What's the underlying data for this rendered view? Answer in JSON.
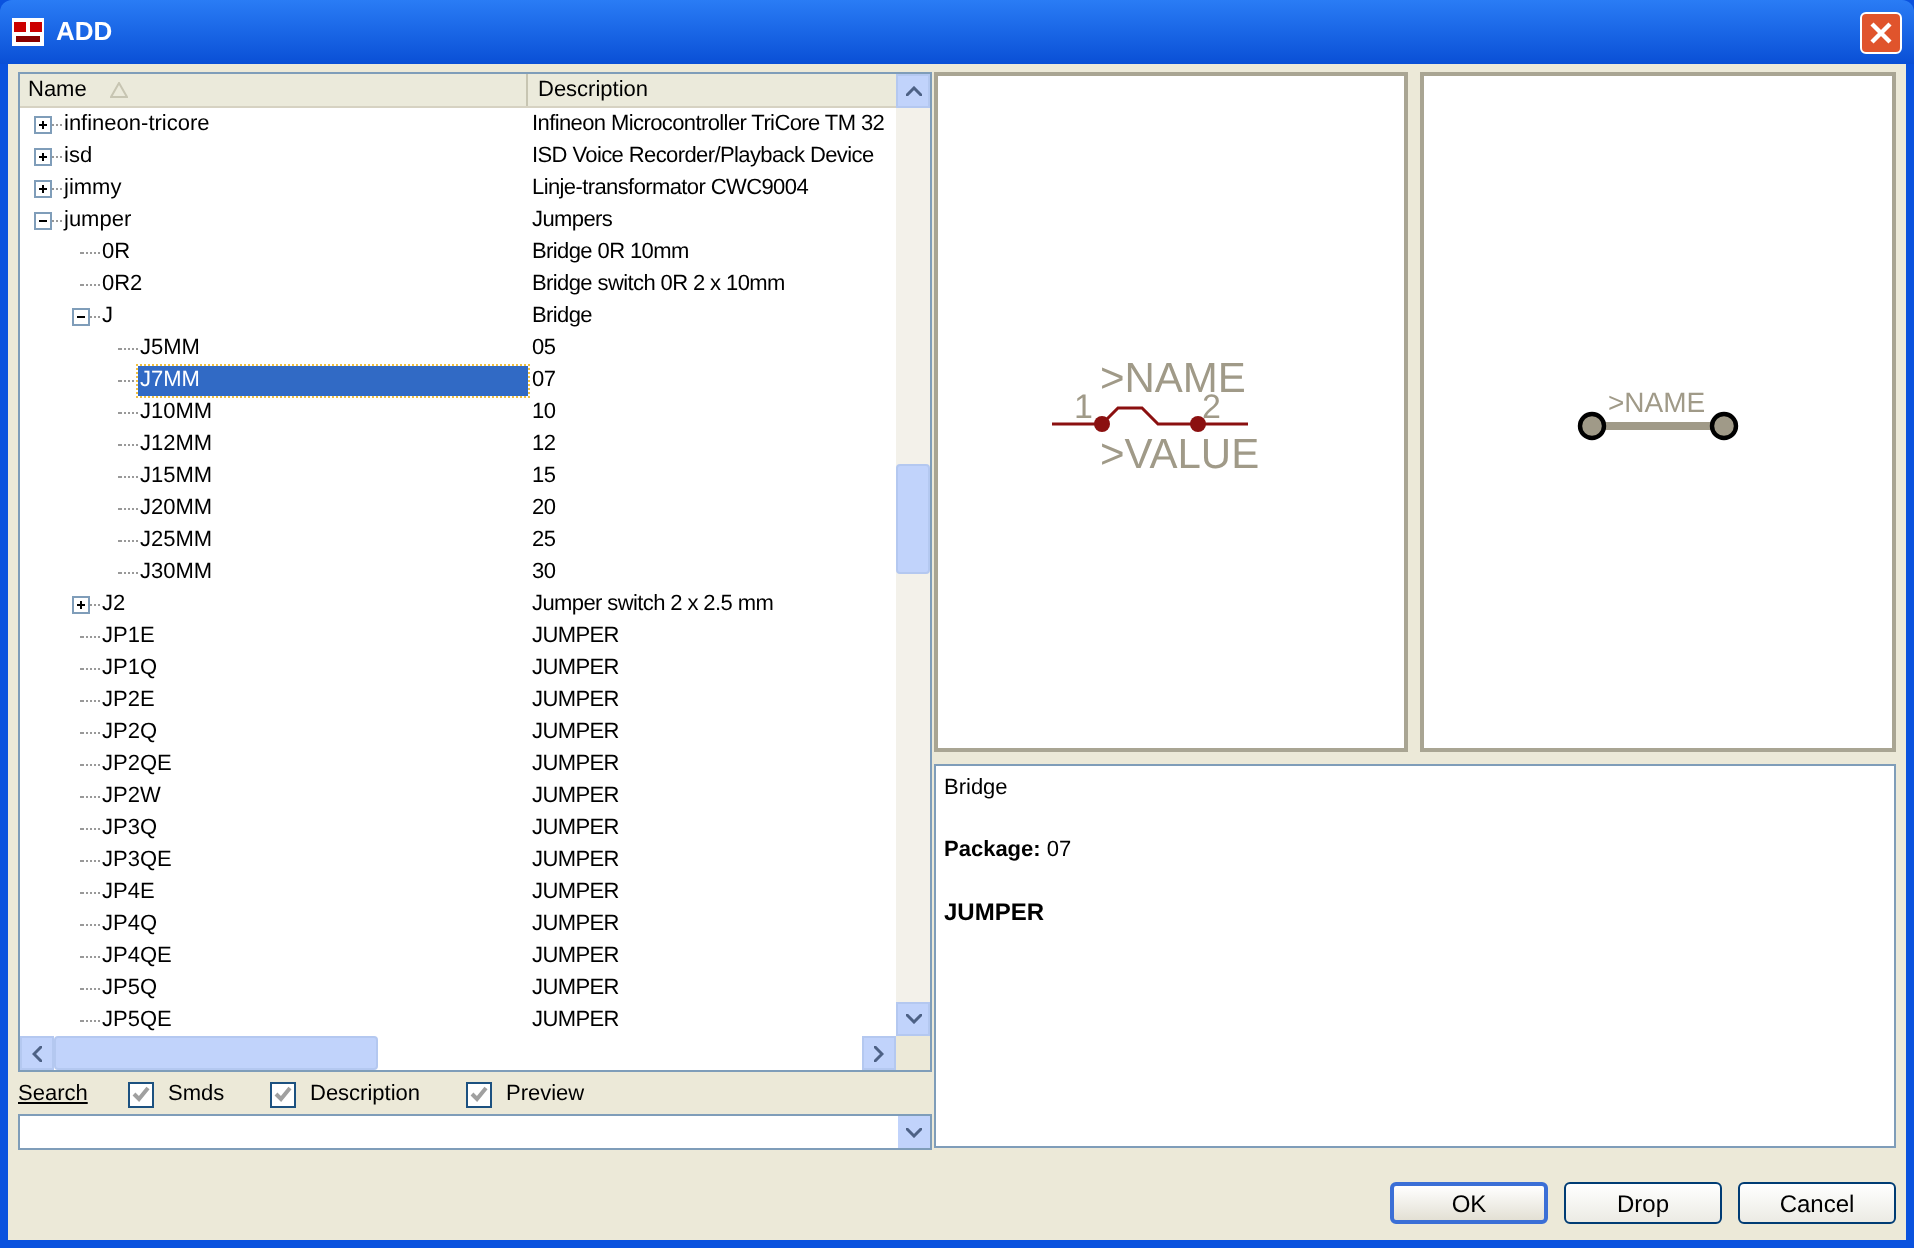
{
  "window": {
    "title": "ADD"
  },
  "tree": {
    "columns": [
      {
        "label": "Name",
        "sorted": true
      },
      {
        "label": "Description",
        "sorted": false
      }
    ],
    "items": [
      {
        "name": "infineon-tricore",
        "description": "Infineon Microcontroller TriCore TM 32",
        "expanded": false,
        "selected": false
      },
      {
        "name": "isd",
        "description": "ISD Voice Recorder/Playback Device",
        "expanded": false,
        "selected": false
      },
      {
        "name": "jimmy",
        "description": "Linje-transformator CWC9004",
        "expanded": false,
        "selected": false
      },
      {
        "name": "jumper",
        "description": "Jumpers",
        "expanded": true,
        "selected": false,
        "children": [
          {
            "name": "0R",
            "description": "Bridge 0R 10mm",
            "selected": false
          },
          {
            "name": "0R2",
            "description": "Bridge switch 0R 2 x 10mm",
            "selected": false
          },
          {
            "name": "J",
            "description": "Bridge",
            "expanded": true,
            "selected": false,
            "children": [
              {
                "name": "J5MM",
                "description": "05",
                "selected": false
              },
              {
                "name": "J7MM",
                "description": "07",
                "selected": true
              },
              {
                "name": "J10MM",
                "description": "10",
                "selected": false
              },
              {
                "name": "J12MM",
                "description": "12",
                "selected": false
              },
              {
                "name": "J15MM",
                "description": "15",
                "selected": false
              },
              {
                "name": "J20MM",
                "description": "20",
                "selected": false
              },
              {
                "name": "J25MM",
                "description": "25",
                "selected": false
              },
              {
                "name": "J30MM",
                "description": "30",
                "selected": false
              }
            ]
          },
          {
            "name": "J2",
            "description": "Jumper switch 2 x 2.5 mm",
            "expanded": false,
            "selected": false
          },
          {
            "name": "JP1E",
            "description": "JUMPER",
            "selected": false
          },
          {
            "name": "JP1Q",
            "description": "JUMPER",
            "selected": false
          },
          {
            "name": "JP2E",
            "description": "JUMPER",
            "selected": false
          },
          {
            "name": "JP2Q",
            "description": "JUMPER",
            "selected": false
          },
          {
            "name": "JP2QE",
            "description": "JUMPER",
            "selected": false
          },
          {
            "name": "JP2W",
            "description": "JUMPER",
            "selected": false
          },
          {
            "name": "JP3Q",
            "description": "JUMPER",
            "selected": false
          },
          {
            "name": "JP3QE",
            "description": "JUMPER",
            "selected": false
          },
          {
            "name": "JP4E",
            "description": "JUMPER",
            "selected": false
          },
          {
            "name": "JP4Q",
            "description": "JUMPER",
            "selected": false
          },
          {
            "name": "JP4QE",
            "description": "JUMPER",
            "selected": false
          },
          {
            "name": "JP5Q",
            "description": "JUMPER",
            "selected": false
          },
          {
            "name": "JP5QE",
            "description": "JUMPER",
            "selected": false
          }
        ]
      }
    ]
  },
  "search": {
    "label": "Search",
    "options": [
      {
        "label": "Smds",
        "checked": true
      },
      {
        "label": "Description",
        "checked": true
      },
      {
        "label": "Preview",
        "checked": true
      }
    ]
  },
  "symbol_preview": {
    "name": ">NAME",
    "value": ">VALUE",
    "pin_1": "1",
    "pin_2": "2"
  },
  "package_preview": {
    "name": ">NAME"
  },
  "details": {
    "lines": [
      {
        "text": "Bridge",
        "kind": "plain"
      },
      {
        "text": "**Package:** 07",
        "kind": "plain"
      },
      {
        "text": "JUMPER",
        "kind": "heading"
      }
    ]
  },
  "buttons": [
    {
      "label": "OK",
      "default": true
    },
    {
      "label": "Drop",
      "default": false
    },
    {
      "label": "Cancel",
      "default": false
    }
  ]
}
